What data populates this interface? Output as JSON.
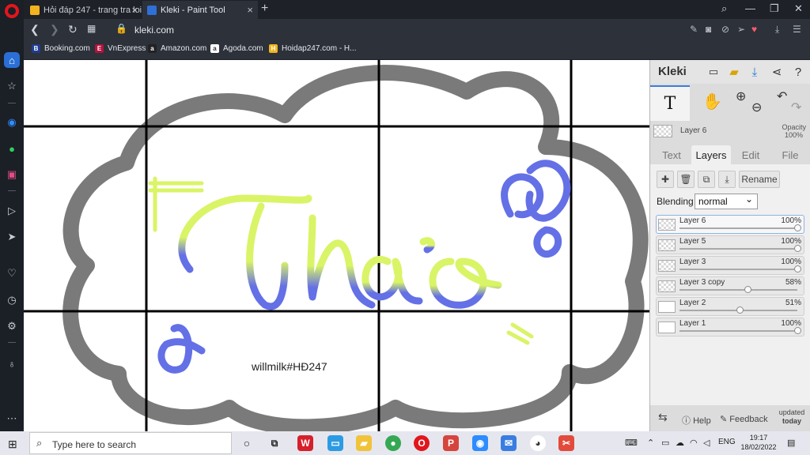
{
  "browser": {
    "tabs": [
      {
        "label": "Hỏi đáp 247 - trang tra loi",
        "active": false
      },
      {
        "label": "Kleki - Paint Tool",
        "active": true
      }
    ],
    "url": "kleki.com",
    "bookmarks": [
      {
        "label": "Booking.com",
        "icon": "B",
        "color": "#1f3d8f"
      },
      {
        "label": "VnExpress",
        "icon": "E",
        "color": "#b4123c"
      },
      {
        "label": "Amazon.com",
        "icon": "a",
        "color": "#222222"
      },
      {
        "label": "Agoda.com",
        "icon": "a",
        "color": "#ffffff"
      },
      {
        "label": "Hoidap247.com - H...",
        "icon": "H",
        "color": "#f2b31f"
      }
    ]
  },
  "canvas": {
    "text_drawn": "Thảo",
    "signature": "willmilk#HĐ247",
    "stroke_colors": {
      "outline": "#757575",
      "yellow": "#d9f466",
      "blue": "#6470e6",
      "grid": "#000000"
    }
  },
  "kleki": {
    "logo": "Kleki",
    "current_layer": "Layer 6",
    "opacity_label": "Opacity",
    "opacity_value": "100%",
    "tabs": [
      "Text",
      "Layers",
      "Edit",
      "File"
    ],
    "active_tab": "Layers",
    "rename_label": "Rename",
    "blending_label": "Blending",
    "blending_value": "normal",
    "layers": [
      {
        "name": "Layer 6",
        "opacity": "100%",
        "value": 1.0,
        "selected": true
      },
      {
        "name": "Layer 5",
        "opacity": "100%",
        "value": 1.0
      },
      {
        "name": "Layer 3",
        "opacity": "100%",
        "value": 1.0
      },
      {
        "name": "Layer 3 copy",
        "opacity": "58%",
        "value": 0.58
      },
      {
        "name": "Layer 2",
        "opacity": "51%",
        "value": 0.51
      },
      {
        "name": "Layer 1",
        "opacity": "100%",
        "value": 1.0
      }
    ],
    "help_label": "Help",
    "feedback_label": "Feedback",
    "updated_line1": "updated",
    "updated_line2": "today"
  },
  "taskbar": {
    "search_placeholder": "Type here to search",
    "lang": "ENG",
    "time": "19:17",
    "date": "18/02/2022"
  }
}
